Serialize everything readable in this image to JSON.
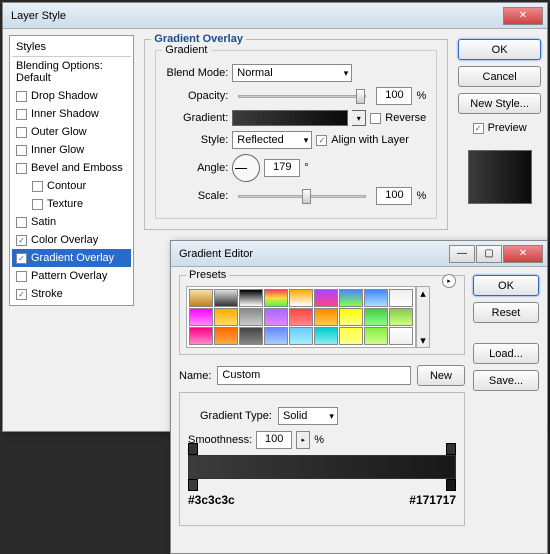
{
  "layerStyle": {
    "title": "Layer Style",
    "sidebar": {
      "header": "Styles",
      "blending": "Blending Options: Default",
      "items": [
        {
          "label": "Drop Shadow",
          "checked": false
        },
        {
          "label": "Inner Shadow",
          "checked": false
        },
        {
          "label": "Outer Glow",
          "checked": false
        },
        {
          "label": "Inner Glow",
          "checked": false
        },
        {
          "label": "Bevel and Emboss",
          "checked": false
        },
        {
          "label": "Contour",
          "checked": false,
          "sub": true
        },
        {
          "label": "Texture",
          "checked": false,
          "sub": true
        },
        {
          "label": "Satin",
          "checked": false
        },
        {
          "label": "Color Overlay",
          "checked": true
        },
        {
          "label": "Gradient Overlay",
          "checked": true,
          "selected": true
        },
        {
          "label": "Pattern Overlay",
          "checked": false
        },
        {
          "label": "Stroke",
          "checked": true
        }
      ]
    },
    "main": {
      "groupTitle": "Gradient Overlay",
      "innerTitle": "Gradient",
      "blendModeLabel": "Blend Mode:",
      "blendMode": "Normal",
      "opacityLabel": "Opacity:",
      "opacity": "100",
      "pct": "%",
      "gradientLabel": "Gradient:",
      "reverseLabel": "Reverse",
      "styleLabel": "Style:",
      "style": "Reflected",
      "alignLabel": "Align with Layer",
      "angleLabel": "Angle:",
      "angle": "179",
      "deg": "°",
      "scaleLabel": "Scale:",
      "scale": "100"
    },
    "buttons": {
      "ok": "OK",
      "cancel": "Cancel",
      "newStyle": "New Style...",
      "preview": "Preview"
    }
  },
  "gradientEditor": {
    "title": "Gradient Editor",
    "presetsLabel": "Presets",
    "nameLabel": "Name:",
    "name": "Custom",
    "newBtn": "New",
    "typeLabel": "Gradient Type:",
    "type": "Solid",
    "smoothLabel": "Smoothness:",
    "smooth": "100",
    "pct": "%",
    "buttons": {
      "ok": "OK",
      "reset": "Reset",
      "load": "Load...",
      "save": "Save..."
    },
    "leftHex": "#3c3c3c",
    "rightHex": "#171717",
    "swatches": [
      "linear-gradient(#f8e0a0,#c08020)",
      "linear-gradient(#ddd,#333)",
      "linear-gradient(#000,#fff)",
      "linear-gradient(#f44,#fd4,#4f4)",
      "linear-gradient(#fa0,transparent)",
      "linear-gradient(#a4f,#f48)",
      "linear-gradient(#48f,#8f4)",
      "linear-gradient(#48f,#adf)",
      "linear-gradient(#eee,#fff)",
      "linear-gradient(#f0f,#f8f)",
      "linear-gradient(#fa0,#fd6)",
      "linear-gradient(#888,#ccc)",
      "linear-gradient(#a6f,#d8f)",
      "linear-gradient(#f44,#f88)",
      "linear-gradient(#f80,#fc4)",
      "linear-gradient(#ff0,#ff8)",
      "linear-gradient(#4c4,#8f8)",
      "linear-gradient(#8c4,#cf8)",
      "linear-gradient(#f08,#f8c)",
      "linear-gradient(#f60,#fa4)",
      "linear-gradient(#444,#888)",
      "linear-gradient(#68f,#acf)",
      "linear-gradient(#6cf,#aef)",
      "linear-gradient(#0cc,#8ee)",
      "linear-gradient(#ff4,#ff8)",
      "linear-gradient(#8e4,#cf8)",
      "linear-gradient(#fff,#eee)"
    ]
  }
}
